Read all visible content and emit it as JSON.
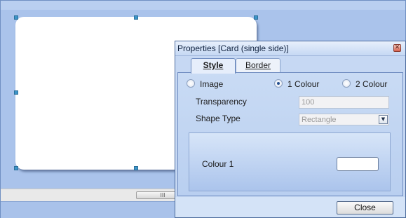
{
  "dialog": {
    "title": "Properties [Card (single side)]",
    "close_glyph": "✕",
    "tabs": [
      {
        "label": "Style",
        "selected": true
      },
      {
        "label": "Border",
        "selected": false
      }
    ],
    "fill_options": [
      {
        "label": "Image",
        "checked": false
      },
      {
        "label": "1 Colour",
        "checked": true
      },
      {
        "label": "2 Colour",
        "checked": false
      }
    ],
    "transparency": {
      "label": "Transparency",
      "value": "100"
    },
    "shape_type": {
      "label": "Shape Type",
      "value": "Rectangle"
    },
    "colour1": {
      "label": "Colour 1",
      "swatch_color": "#ffffff"
    },
    "close_button": "Close"
  },
  "scrollbar": {
    "thumb_grip": "III"
  },
  "colors": {
    "canvas_bg": "#aac3eb",
    "card": "#ffffff",
    "handles": "#3d94c8",
    "dialog_bg": "#c6d8f3"
  }
}
